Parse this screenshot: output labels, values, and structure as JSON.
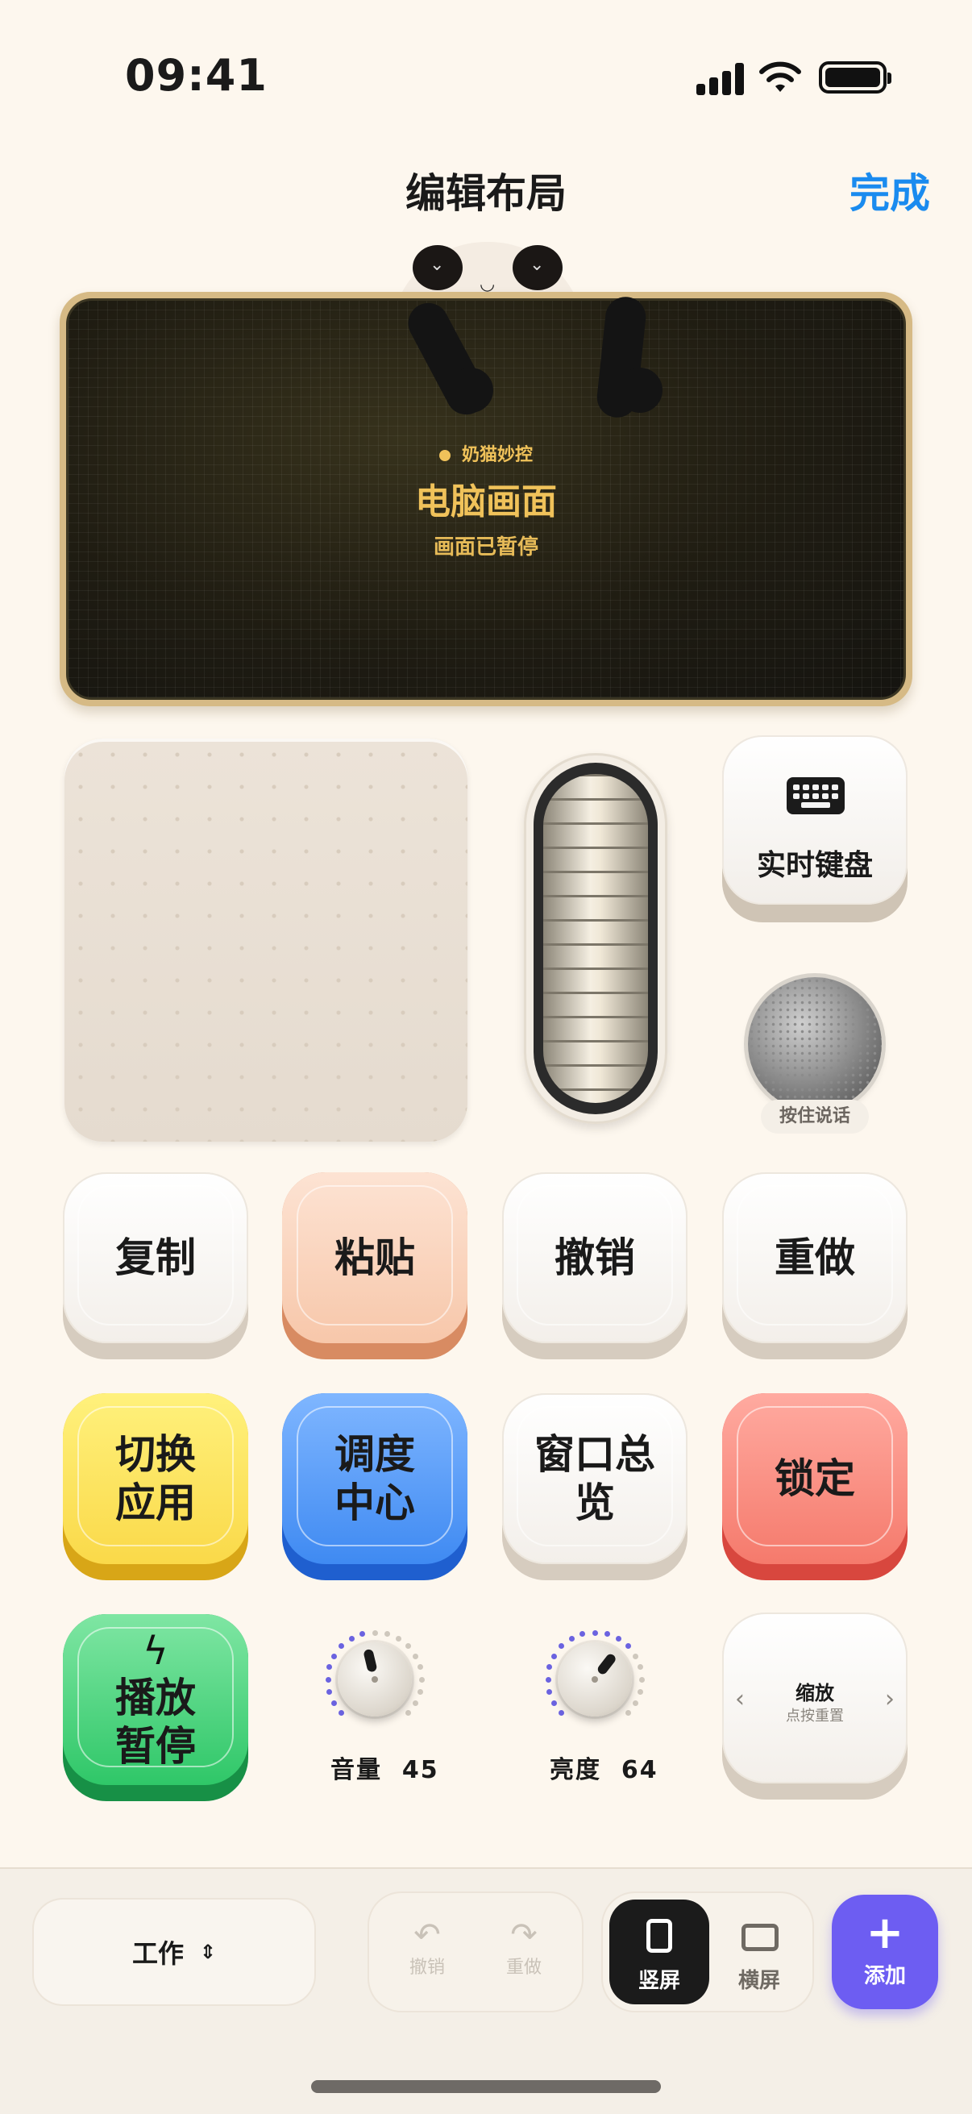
{
  "status_bar": {
    "time": "09:41"
  },
  "header": {
    "title": "编辑布局",
    "done_label": "完成"
  },
  "screen": {
    "tag": "奶猫妙控",
    "title": "电脑画面",
    "subtitle": "画面已暂停"
  },
  "widgets": {
    "keyboard_label": "实时键盘",
    "mic_label": "按住说话"
  },
  "keys": {
    "row1": [
      "复制",
      "粘贴",
      "撤销",
      "重做"
    ],
    "row2": [
      "切换\n应用",
      "调度\n中心",
      "窗口总\n览",
      "锁定"
    ],
    "play_pause": "播放\n暂停"
  },
  "knobs": {
    "volume": {
      "label": "音量",
      "value": 45
    },
    "brightness": {
      "label": "亮度",
      "value": 64
    }
  },
  "zoom": {
    "title": "缩放",
    "subtitle": "点按重置"
  },
  "bottom_bar": {
    "mode": "工作",
    "undo_label": "撤销",
    "redo_label": "重做",
    "portrait_label": "竖屏",
    "landscape_label": "横屏",
    "add_label": "添加"
  },
  "colors": {
    "accent_blue": "#1a8bef",
    "add_button": "#6d5df2",
    "screen_text": "#f0c25a",
    "knob_ticks_active": "#6b63e0"
  },
  "icons": {
    "keyboard": "keyboard-icon",
    "lightning": "lightning-icon",
    "undo": "undo-icon",
    "redo": "redo-icon",
    "portrait": "portrait-icon",
    "landscape": "landscape-icon",
    "add": "plus-icon"
  }
}
